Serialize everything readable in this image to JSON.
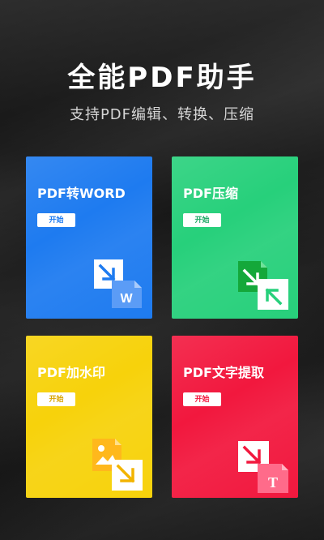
{
  "header": {
    "title": "全能PDF助手",
    "subtitle": "支持PDF编辑、转换、压缩"
  },
  "cards": [
    {
      "title": "PDF转WORD",
      "button": "开始",
      "color": "#1e7bf0",
      "icon": "pdf-to-word-icon",
      "icon_letter": "W"
    },
    {
      "title": "PDF压缩",
      "button": "开始",
      "color": "#27d07b",
      "icon": "compress-icon"
    },
    {
      "title": "PDF加水印",
      "button": "开始",
      "color": "#f7d20b",
      "icon": "watermark-icon"
    },
    {
      "title": "PDF文字提取",
      "button": "开始",
      "color": "#f2183e",
      "icon": "text-extract-icon",
      "icon_letter": "T"
    }
  ]
}
